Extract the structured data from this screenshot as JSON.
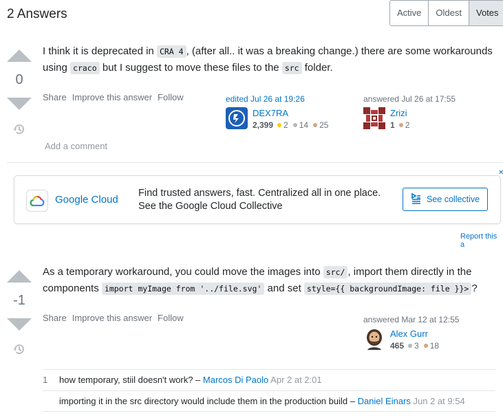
{
  "header": {
    "title": "2 Answers",
    "sort_tabs": [
      "Active",
      "Oldest",
      "Votes"
    ],
    "active_tab": "Votes"
  },
  "answer1": {
    "score": "0",
    "text": {
      "p1": "I think it is deprecated in ",
      "code1": "CRA 4",
      "p2": ", (after all.. it was a breaking change.) there are some workarounds using ",
      "code2": "craco",
      "p3": " but I suggest to move these files to the ",
      "code3": "src",
      "p4": " folder."
    },
    "menu": {
      "share": "Share",
      "improve": "Improve this answer",
      "follow": "Follow"
    },
    "editor": {
      "action": "edited Jul 26 at 19:26",
      "name": "DEX7RA",
      "rep": "2,399",
      "gold": "2",
      "silver": "14",
      "bronze": "25"
    },
    "author": {
      "action": "answered Jul 26 at 17:55",
      "name": "Zrizi",
      "rep": "1",
      "bronze": "2"
    },
    "add_comment": "Add a comment"
  },
  "ad": {
    "name": "Google Cloud",
    "line1": "Find trusted answers, fast. Centralized all in one place.",
    "line2": "See the Google Cloud Collective",
    "button": "See collective",
    "report": "Report this a"
  },
  "answer2": {
    "score": "-1",
    "text": {
      "p1": "As a temporary workaround, you could move the images into ",
      "code1": "src/",
      "p2": ", import them directly in the components ",
      "code2": "import myImage from '../file.svg'",
      "p3": " and set ",
      "code3": "style={{ backgroundImage: file }}>",
      "p4": "?"
    },
    "menu": {
      "share": "Share",
      "improve": "Improve this answer",
      "follow": "Follow"
    },
    "author": {
      "action": "answered Mar 12 at 12:55",
      "name": "Alex Gurr",
      "rep": "465",
      "silver": "3",
      "bronze": "18"
    },
    "comments": [
      {
        "score": "1",
        "text": "how temporary, stiil doesn't work? – ",
        "user": "Marcos Di Paolo",
        "date": "Apr 2 at 2:01"
      },
      {
        "score": "",
        "text": "importing it in the src directory would include them in the production build – ",
        "user": "Daniel Einars",
        "date": "Jun 2 at 9:54"
      }
    ]
  },
  "colors": {
    "link": "#0074cc",
    "muted": "#6a737c",
    "vote_arrow": "#babfc4",
    "gold": "#ffcc01",
    "silver": "#b4b8bc",
    "bronze": "#d1a684"
  }
}
